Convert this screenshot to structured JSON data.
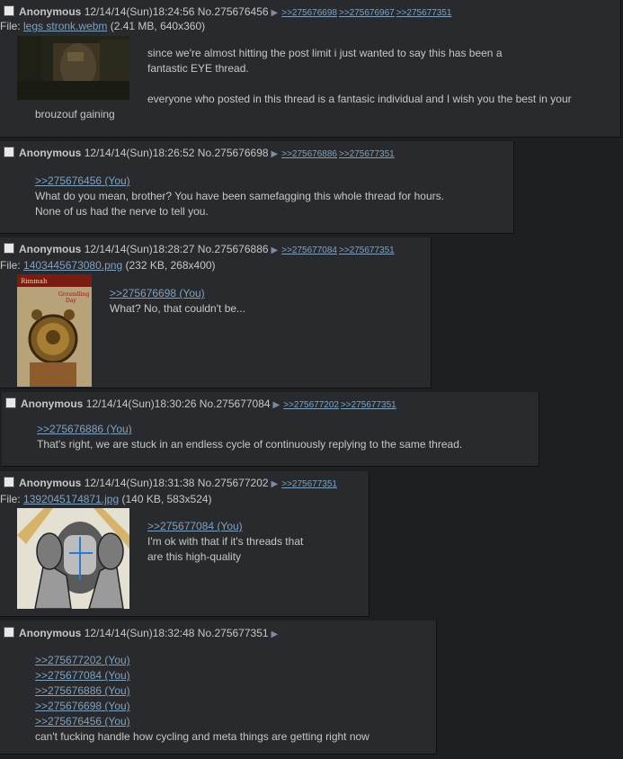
{
  "posts": [
    {
      "name": "Anonymous",
      "datetime": "12/14/14(Sun)18:24:56",
      "no": "No.275676456",
      "backlinks": [
        ">>275676698",
        ">>275676967",
        ">>275677351"
      ],
      "file_label": "File:",
      "file_name": "legs stronk.webm",
      "file_info": "(2.41 MB, 640x360)",
      "body": [
        "since we're almost hitting the post limit i just wanted to say this has been a fantastic EYE thread.",
        "everyone who posted in this thread is a fantasic individual and I wish you the best in your brouzouf gaining"
      ]
    },
    {
      "name": "Anonymous",
      "datetime": "12/14/14(Sun)18:26:52",
      "no": "No.275676698",
      "backlinks": [
        ">>275676886",
        ">>275677351"
      ],
      "quotes": [
        ">>275676456 (You)"
      ],
      "body": [
        "What do you mean, brother? You have been samefagging this whole thread for hours.",
        "None of us had the nerve to tell you."
      ]
    },
    {
      "name": "Anonymous",
      "datetime": "12/14/14(Sun)18:28:27",
      "no": "No.275676886",
      "backlinks": [
        ">>275677084",
        ">>275677351"
      ],
      "file_label": "File:",
      "file_name": "1403445673080.png",
      "file_info": "(232 KB, 268x400)",
      "thumb_text": [
        "Rimmah",
        "Groundling",
        "Day"
      ],
      "quotes": [
        ">>275676698 (You)"
      ],
      "body": [
        "What? No, that couldn't be..."
      ]
    },
    {
      "name": "Anonymous",
      "datetime": "12/14/14(Sun)18:30:26",
      "no": "No.275677084",
      "backlinks": [
        ">>275677202",
        ">>275677351"
      ],
      "quotes": [
        ">>275676886 (You)"
      ],
      "body": [
        "That's right, we are stuck in an endless cycle of continuously replying to the same thread."
      ]
    },
    {
      "name": "Anonymous",
      "datetime": "12/14/14(Sun)18:31:38",
      "no": "No.275677202",
      "backlinks": [
        ">>275677351"
      ],
      "file_label": "File:",
      "file_name": "1392045174871.jpg",
      "file_info": "(140 KB, 583x524)",
      "quotes": [
        ">>275677084 (You)"
      ],
      "body": [
        "I'm ok with that if it's threads that",
        "are this high-quality"
      ]
    },
    {
      "name": "Anonymous",
      "datetime": "12/14/14(Sun)18:32:48",
      "no": "No.275677351",
      "backlinks": [],
      "quotes": [
        ">>275677202 (You)",
        ">>275677084 (You)",
        ">>275676886 (You)",
        ">>275676698 (You)",
        ">>275676456 (You)"
      ],
      "body": [
        "can't fucking handle how cycling and meta things are getting right now"
      ]
    }
  ],
  "colors": {
    "background": "#1d1f21",
    "post": "#282a2e",
    "link": "#81a2be",
    "text": "#c5c8c6"
  },
  "icons": {
    "checkbox": "checkbox-icon",
    "arrow": "post-menu-arrow-icon"
  }
}
